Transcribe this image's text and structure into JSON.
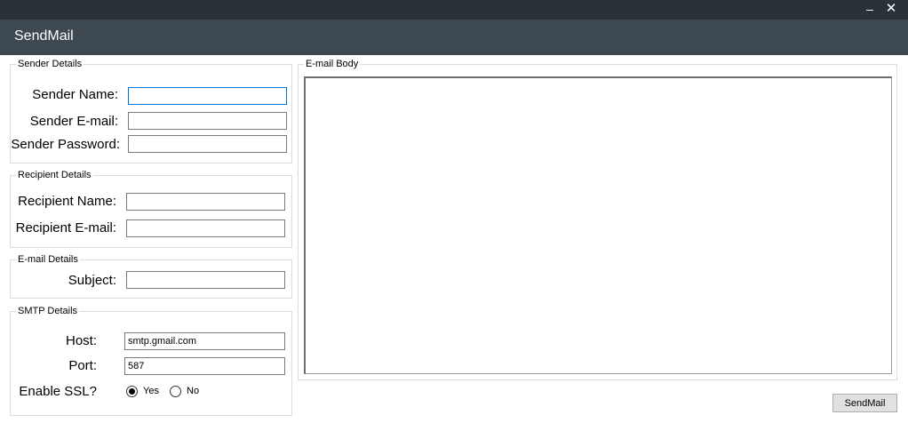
{
  "window": {
    "minimize_glyph": "–",
    "close_glyph": "✕",
    "title": "SendMail"
  },
  "sender": {
    "group_label": "Sender Details",
    "name_label": "Sender Name:",
    "name_value": "",
    "email_label": "Sender E-mail:",
    "email_value": "",
    "password_label": "Sender Password:",
    "password_value": ""
  },
  "recipient": {
    "group_label": "Recipient Details",
    "name_label": "Recipient Name:",
    "name_value": "",
    "email_label": "Recipient E-mail:",
    "email_value": ""
  },
  "email": {
    "group_label": "E-mail Details",
    "subject_label": "Subject:",
    "subject_value": ""
  },
  "smtp": {
    "group_label": "SMTP Details",
    "host_label": "Host:",
    "host_value": "smtp.gmail.com",
    "port_label": "Port:",
    "port_value": "587",
    "ssl_label": "Enable SSL?",
    "ssl_yes_label": "Yes",
    "ssl_no_label": "No",
    "ssl_selected": "Yes"
  },
  "body": {
    "group_label": "E-mail Body",
    "value": ""
  },
  "actions": {
    "send_label": "SendMail"
  },
  "colors": {
    "titlebar": "#2a3239",
    "header": "#3d4851",
    "focus_border": "#0078d7"
  }
}
